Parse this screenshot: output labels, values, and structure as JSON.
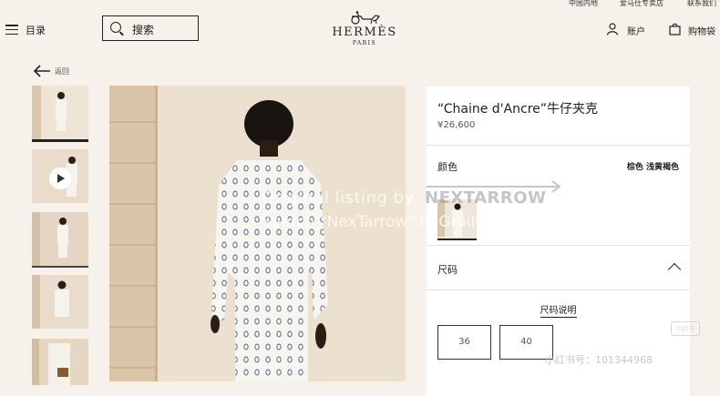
{
  "topbar": {
    "region": "中国内地",
    "store": "爱马仕专卖店",
    "contact": "联系我们"
  },
  "header": {
    "menu_label": "目录",
    "search_label": "搜索",
    "logo_text": "HERMÈS",
    "logo_sub": "PARIS",
    "account_label": "账户",
    "bag_label": "购物袋"
  },
  "nav": {
    "back_label": "返回"
  },
  "product": {
    "title": "“Chaine d'Ancre”牛仔夹克",
    "price": "¥26,600",
    "color_label": "颜色",
    "color_value": "棕色 浅黄褐色",
    "size_label": "尺码",
    "size_guide": "尺码说明",
    "sizes": [
      "36",
      "40"
    ]
  },
  "watermark": {
    "line1": "Original listing by",
    "brand": "NEXTARROW",
    "line2": "Search \"NexTarrow\" in Grailed app.",
    "xhs_id": "小红书号：101344968",
    "xhs_logo": "小红书"
  },
  "colors": {
    "background": "#f6f1eb",
    "panel": "#ffffff",
    "text": "#222222"
  }
}
